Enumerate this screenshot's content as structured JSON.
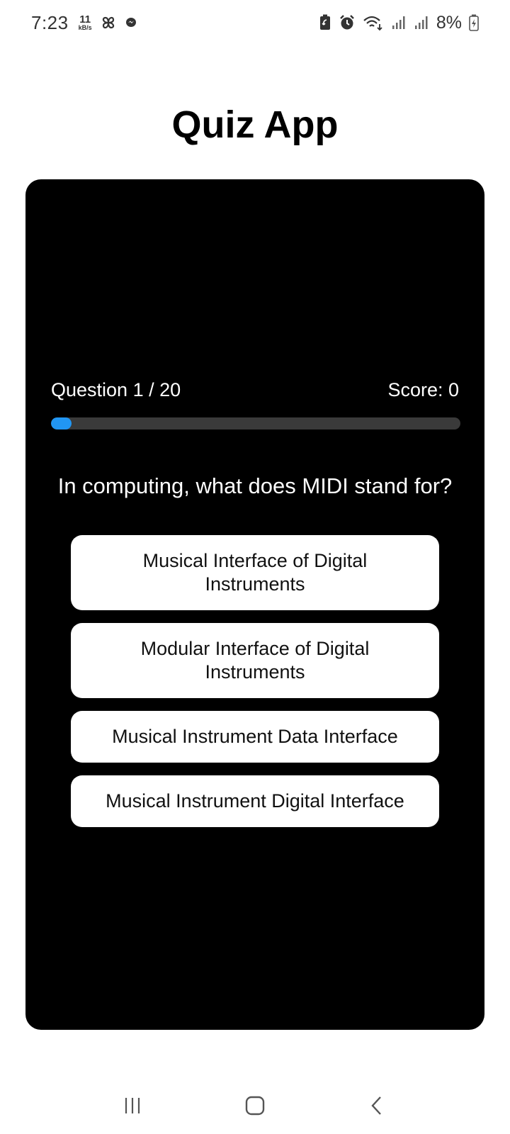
{
  "status_bar": {
    "time": "7:23",
    "net_speed_value": "11",
    "net_speed_unit": "kB/s",
    "battery_percent": "8%",
    "icons": [
      "pinwheel-icon",
      "messenger-icon",
      "battery-saver-icon",
      "alarm-icon",
      "wifi-icon",
      "signal-icon",
      "signal-icon",
      "battery-icon"
    ]
  },
  "app": {
    "title": "Quiz App"
  },
  "quiz": {
    "question_counter": "Question 1 / 20",
    "score": "Score: 0",
    "progress_fraction": 0.05,
    "question": "In computing, what does MIDI stand for?",
    "answers": [
      "Musical Interface of Digital Instruments",
      "Modular Interface of Digital Instruments",
      "Musical Instrument Data Interface",
      "Musical Instrument Digital Interface"
    ]
  },
  "colors": {
    "card_bg": "#000000",
    "progress_fill": "#2196f3",
    "progress_track": "#3a3a3a",
    "answer_bg": "#ffffff"
  },
  "nav_bar": {
    "icons": [
      "recents-icon",
      "home-icon",
      "back-icon"
    ]
  }
}
